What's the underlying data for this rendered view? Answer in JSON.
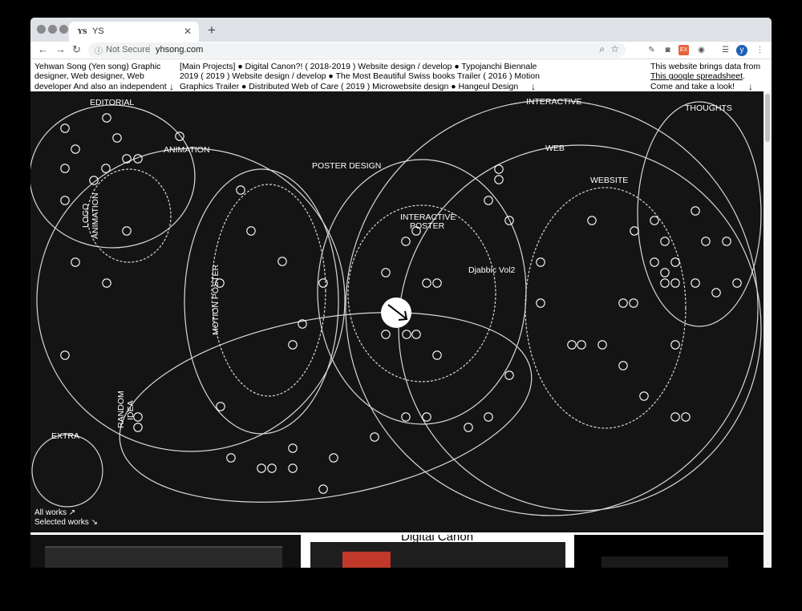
{
  "browser": {
    "tab_title": "YS",
    "tab_favicon": "YS",
    "new_tab": "+",
    "security_label": "Not Secure",
    "url": "yhsong.com",
    "profile_initial": "y",
    "ext_badge": "EX"
  },
  "header": {
    "intro": "Yehwan Song (Yen song) Graphic designer, Web designer, Web developer And also an independent",
    "projects": "[Main Projects] ● Digital Canon?! ( 2018-2019 ) Website design / develop ● Typojanchi Biennale 2019 ( 2019 ) Website design / develop ● The Most Beautiful Swiss books Trailer ( 2016 ) Motion Graphics Trailer ● Distributed Web of Care ( 2019 ) Microwebsite design ● Hangeul Design Project | National Hangeul",
    "note_before": "This website brings data from ",
    "note_link": "This google spreadsheet",
    "note_after": ". Come and take a look!",
    "arrow": "↓"
  },
  "map": {
    "labels": {
      "editorial": "EDITORIAL",
      "animation": "ANIMATION",
      "logo_animation_1": "LOGO",
      "logo_animation_2": "ANIMATION",
      "poster_design": "POSTER DESIGN",
      "motion_poster": "MOTION POSTER",
      "interactive": "INTERACTIVE",
      "interactive_poster_1": "INTERACTIVE",
      "interactive_poster_2": "POSTER",
      "web": "WEB",
      "website": "WEBSITE",
      "thoughts": "THOUGHTS",
      "random_idea_1": "RANDOM",
      "random_idea_2": "IDEA",
      "extra": "EXTRA",
      "hover_item": "Djabbic Vol2"
    },
    "all_works": "All works ↗",
    "selected_works": "Selected works ↘"
  },
  "thumbnails": {
    "second_caption": "Digital Canon"
  },
  "colors": {
    "canvas": "#141414",
    "line": "#d8d8d8",
    "dot": "#ffffff"
  }
}
